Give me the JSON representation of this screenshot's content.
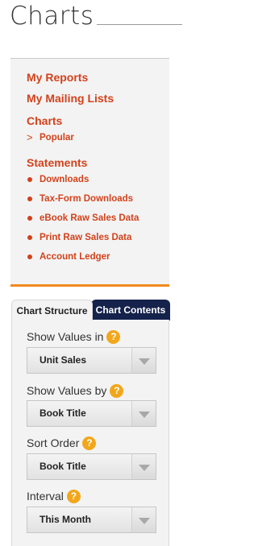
{
  "header": {
    "title": "Charts"
  },
  "nav": {
    "my_reports": "My Reports",
    "my_mailing_lists": "My Mailing Lists",
    "charts": {
      "label": "Charts",
      "items": [
        {
          "marker": ">",
          "label": "Popular"
        }
      ]
    },
    "statements": {
      "label": "Statements",
      "items": [
        {
          "label": "Downloads"
        },
        {
          "label": "Tax-Form Downloads"
        },
        {
          "label": "eBook Raw Sales Data"
        },
        {
          "label": "Print Raw Sales Data"
        },
        {
          "label": "Account Ledger"
        }
      ]
    }
  },
  "tabs": [
    {
      "label": "Chart Structure",
      "active": true
    },
    {
      "label": "Chart Contents",
      "active": false
    }
  ],
  "help_symbol": "?",
  "fields": [
    {
      "label": "Show Values in",
      "value": "Unit Sales"
    },
    {
      "label": "Show Values by",
      "value": "Book Title"
    },
    {
      "label": "Sort Order",
      "value": "Book Title"
    },
    {
      "label": "Interval",
      "value": "This Month"
    }
  ],
  "colors": {
    "accent": "#d2421c",
    "orange_rule": "#f08a1c",
    "help_icon": "#f2a71b",
    "active_tab_dark": "#15224b"
  }
}
